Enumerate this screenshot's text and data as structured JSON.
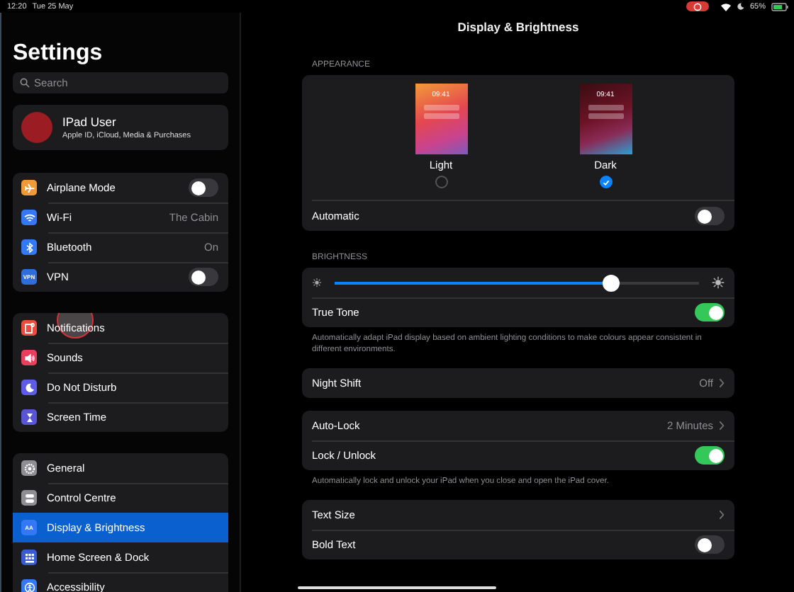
{
  "status_bar": {
    "time": "12:20",
    "date": "Tue 25 May",
    "battery_text": "65%"
  },
  "sidebar": {
    "title": "Settings",
    "search": {
      "placeholder": "Search"
    },
    "profile": {
      "name": "IPad User",
      "subtitle": "Apple ID, iCloud, Media & Purchases"
    },
    "groups": [
      {
        "items": [
          {
            "color": "#f09a37",
            "label": "Airplane Mode",
            "kind": "toggle",
            "on": false,
            "selected": false
          },
          {
            "color": "#3478f6",
            "label": "Wi-Fi",
            "kind": "value",
            "value": "The Cabin",
            "selected": false
          },
          {
            "color": "#3478f6",
            "label": "Bluetooth",
            "kind": "value",
            "value": "On",
            "selected": false
          },
          {
            "icon_text": "VPN",
            "color": "#2f6ddb",
            "label": "VPN",
            "kind": "toggle",
            "on": false,
            "selected": false
          }
        ]
      },
      {
        "items": [
          {
            "color": "#eb4d3d",
            "label": "Notifications",
            "kind": "plain",
            "selected": false
          },
          {
            "color": "#e93e5c",
            "label": "Sounds",
            "kind": "plain",
            "selected": false
          },
          {
            "color": "#5e5ce6",
            "label": "Do Not Disturb",
            "kind": "plain",
            "selected": false
          },
          {
            "color": "#5856d6",
            "label": "Screen Time",
            "kind": "plain",
            "selected": false
          }
        ]
      },
      {
        "items": [
          {
            "color": "#8e8e93",
            "label": "General",
            "kind": "plain",
            "selected": false
          },
          {
            "color": "#8e8e93",
            "label": "Control Centre",
            "kind": "plain",
            "selected": false
          },
          {
            "icon_text": "AA",
            "color": "#3478f6",
            "label": "Display & Brightness",
            "kind": "plain",
            "selected": true
          },
          {
            "color": "#3a5bd6",
            "label": "Home Screen & Dock",
            "kind": "plain",
            "selected": false
          },
          {
            "color": "#3478f6",
            "label": "Accessibility",
            "kind": "plain",
            "selected": false
          }
        ]
      }
    ]
  },
  "main": {
    "title": "Display & Brightness",
    "sections": [
      {
        "header": "APPEARANCE",
        "rows": [
          {
            "kind": "appearance",
            "options": [
              {
                "time": "09:41",
                "label": "Light",
                "selected": false
              },
              {
                "time": "09:41",
                "label": "Dark",
                "selected": true
              }
            ]
          },
          {
            "kind": "toggle",
            "label": "Automatic",
            "on": false
          }
        ]
      },
      {
        "header": "BRIGHTNESS",
        "rows": [
          {
            "kind": "slider",
            "level": 0.76
          },
          {
            "kind": "toggle",
            "label": "True Tone",
            "on": true
          }
        ],
        "footer": "Automatically adapt iPad display based on ambient lighting conditions to make colours appear consistent in different environments."
      },
      {
        "rows": [
          {
            "kind": "value",
            "label": "Night Shift",
            "value": "Off"
          }
        ]
      },
      {
        "rows": [
          {
            "kind": "value",
            "label": "Auto-Lock",
            "value": "2 Minutes"
          },
          {
            "kind": "toggle",
            "label": "Lock / Unlock",
            "on": true
          }
        ],
        "footer": "Automatically lock and unlock your iPad when you close and open the iPad cover."
      },
      {
        "rows": [
          {
            "kind": "value",
            "label": "Text Size"
          },
          {
            "kind": "toggle",
            "label": "Bold Text",
            "on": false
          }
        ]
      }
    ]
  }
}
